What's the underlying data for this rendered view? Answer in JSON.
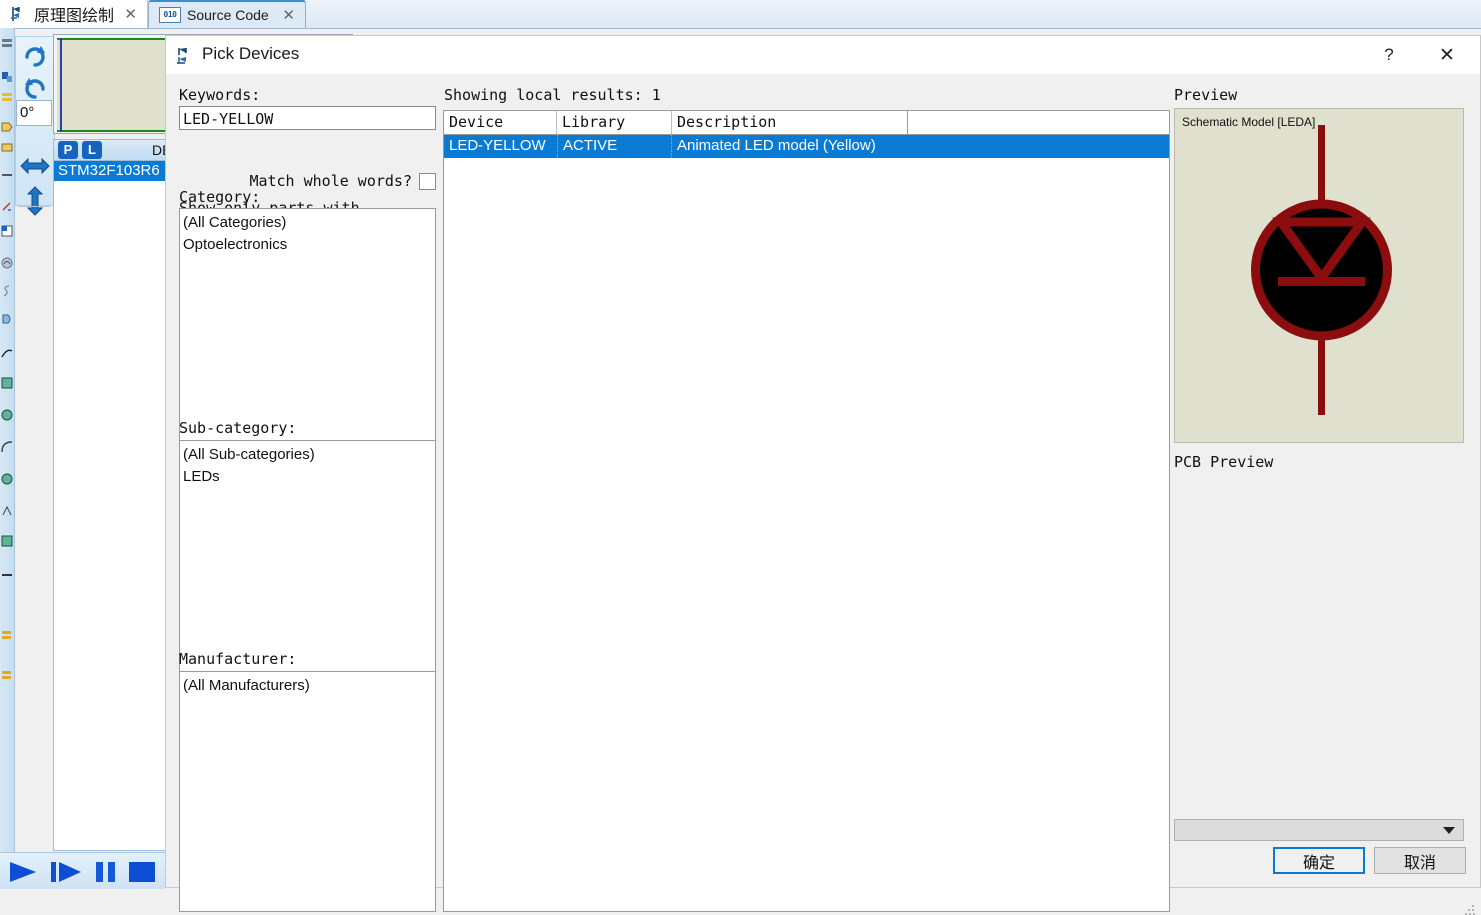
{
  "tabs": [
    {
      "label": "原理图绘制",
      "icon": "schematic-icon",
      "close": "✕"
    },
    {
      "label": "Source Code",
      "icon": "source-code-icon",
      "close": "✕",
      "icon_text": "010"
    }
  ],
  "sidebar": {
    "rotation_angle": "0°",
    "rotate_cw": "rotate-clockwise-icon",
    "rotate_ccw": "rotate-counterclockwise-icon",
    "mirror_x": "mirror-horizontal-icon",
    "mirror_y": "mirror-vertical-icon",
    "devices_panel": {
      "p_button": "P",
      "l_button": "L",
      "title": "DEVICES",
      "items": [
        "STM32F103R6"
      ]
    }
  },
  "transport": {
    "play": "play-button",
    "step": "step-button",
    "pause": "pause-button",
    "stop": "stop-button"
  },
  "dialog": {
    "title": "Pick Devices",
    "help_label": "?",
    "close_label": "✕",
    "keywords_label": "Keywords:",
    "keywords_value": "LED-YELLOW",
    "keywords_placeholder": "",
    "match_whole_words_label": "Match whole words?",
    "show_only_models_label": "Show only parts with models?",
    "category_label": "Category:",
    "categories": [
      "(All Categories)",
      "Optoelectronics"
    ],
    "subcategory_label": "Sub-category:",
    "subcategories": [
      "(All Sub-categories)",
      "LEDs"
    ],
    "manufacturer_label": "Manufacturer:",
    "manufacturers": [
      "(All Manufacturers)"
    ],
    "results_info": "Showing local results: 1",
    "results_columns": [
      "Device",
      "Library",
      "Description"
    ],
    "results_rows": [
      {
        "device": "LED-YELLOW",
        "library": "ACTIVE",
        "description": "Animated LED model (Yellow)",
        "selected": true
      }
    ],
    "preview_label": "Preview",
    "preview_caption": "Schematic Model [LEDA]",
    "pcb_preview_label": "PCB Preview",
    "package_combo_value": "",
    "ok_label": "确定",
    "cancel_label": "取消"
  },
  "colors": {
    "accent": "#0a7bd4",
    "schematic_bg": "#dfe0ce",
    "symbol_red": "#8b0d0d",
    "dialog_bg": "#f0f0f0"
  }
}
